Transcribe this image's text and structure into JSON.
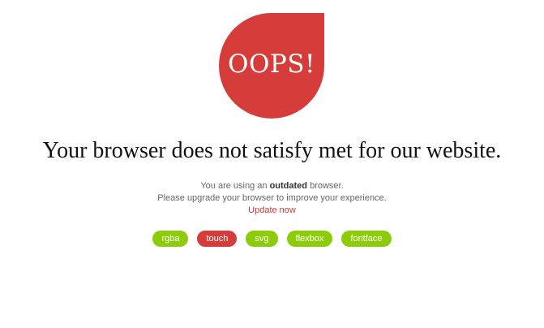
{
  "badge": {
    "text": "OOPS!",
    "color": "#d63d3a"
  },
  "headline": "Your browser does not satisfy met for our website.",
  "info": {
    "line1_prefix": "You are using an ",
    "line1_bold": "outdated",
    "line1_suffix": " browser.",
    "line2": "Please upgrade your browser to improve your experience.",
    "update_link": "Update now"
  },
  "features": [
    {
      "label": "rgba",
      "status": "supported",
      "color": "#8ccc0b"
    },
    {
      "label": "touch",
      "status": "unsupported",
      "color": "#d63d3a"
    },
    {
      "label": "svg",
      "status": "supported",
      "color": "#8ccc0b"
    },
    {
      "label": "flexbox",
      "status": "supported",
      "color": "#8ccc0b"
    },
    {
      "label": "fontface",
      "status": "supported",
      "color": "#8ccc0b"
    }
  ]
}
